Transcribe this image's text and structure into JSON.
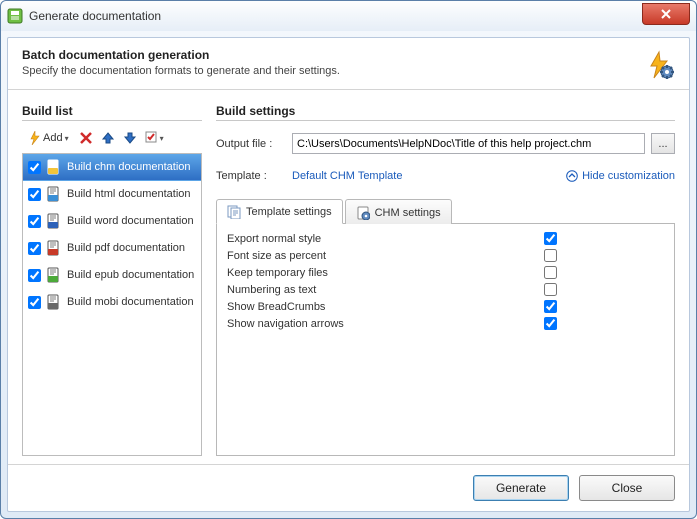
{
  "window": {
    "title": "Generate documentation"
  },
  "banner": {
    "heading": "Batch documentation generation",
    "sub": "Specify the documentation formats to generate and their settings."
  },
  "left": {
    "heading": "Build list",
    "add_label": "Add",
    "items": [
      {
        "label": "Build chm documentation",
        "checked": true,
        "selected": true,
        "icon": "chm"
      },
      {
        "label": "Build html documentation",
        "checked": true,
        "selected": false,
        "icon": "html"
      },
      {
        "label": "Build word documentation",
        "checked": true,
        "selected": false,
        "icon": "word"
      },
      {
        "label": "Build pdf documentation",
        "checked": true,
        "selected": false,
        "icon": "pdf"
      },
      {
        "label": "Build epub documentation",
        "checked": true,
        "selected": false,
        "icon": "epub"
      },
      {
        "label": "Build mobi documentation",
        "checked": true,
        "selected": false,
        "icon": "mobi"
      }
    ]
  },
  "right": {
    "heading": "Build settings",
    "output_label": "Output file :",
    "output_value": "C:\\Users\\Documents\\HelpNDoc\\Title of this help project.chm",
    "template_label": "Template :",
    "template_value": "Default CHM Template",
    "hide_cust": "Hide customization",
    "tabs": [
      {
        "label": "Template settings",
        "active": true
      },
      {
        "label": "CHM settings",
        "active": false
      }
    ],
    "options": [
      {
        "label": "Export normal style",
        "checked": true
      },
      {
        "label": "Font size as percent",
        "checked": false
      },
      {
        "label": "Keep temporary files",
        "checked": false
      },
      {
        "label": "Numbering as text",
        "checked": false
      },
      {
        "label": "Show BreadCrumbs",
        "checked": true
      },
      {
        "label": "Show navigation arrows",
        "checked": true
      }
    ]
  },
  "footer": {
    "generate": "Generate",
    "close": "Close"
  }
}
